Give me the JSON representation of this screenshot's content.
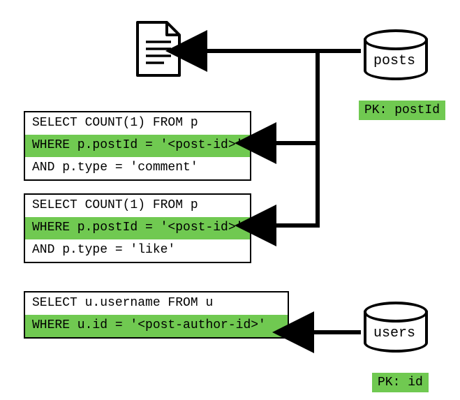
{
  "db1": {
    "label": "posts",
    "pk": "PK: postId"
  },
  "db2": {
    "label": "users",
    "pk": "PK: id"
  },
  "q1": {
    "l1": "SELECT COUNT(1) FROM p",
    "l2": "WHERE p.postId = '<post-id>'",
    "l3": "AND p.type = 'comment'"
  },
  "q2": {
    "l1": "SELECT COUNT(1) FROM p",
    "l2": "WHERE p.postId = '<post-id>'",
    "l3": "AND p.type = 'like'"
  },
  "q3": {
    "l1": "SELECT u.username FROM u",
    "l2": "WHERE u.id = '<post-author-id>'"
  }
}
